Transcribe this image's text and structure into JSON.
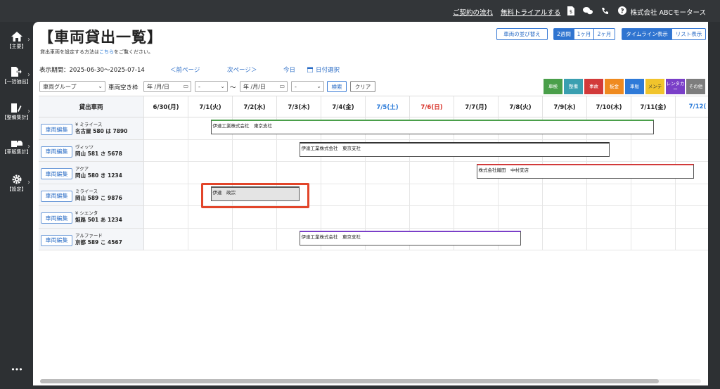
{
  "topbar": {
    "contract_flow": "ご契約の流れ",
    "free_trial": "無料トライアルする",
    "company": "株式会社 ABCモータース",
    "icons": [
      "document-yen-icon",
      "chat-icon",
      "phone-icon",
      "help-icon"
    ]
  },
  "sidebar": {
    "items": [
      {
        "label": "【主要】",
        "icon": "home-icon"
      },
      {
        "label": "【一括抽出】",
        "icon": "export-icon"
      },
      {
        "label": "【整備集計】",
        "icon": "wrench-icon"
      },
      {
        "label": "【車販集計】",
        "icon": "car-icon"
      },
      {
        "label": "【設定】",
        "icon": "gear-icon"
      }
    ],
    "more": "•••"
  },
  "page": {
    "title": "【車両貸出一覧】",
    "subtitle_pre": "貸出車両を設定する方法は",
    "subtitle_link": "こちら",
    "subtitle_post": "をご覧ください。"
  },
  "toolbar": {
    "reorder": "車両の並び替え",
    "range": [
      "2週間",
      "1ヶ月",
      "2ヶ月"
    ],
    "range_active": "2週間",
    "view": [
      "タイムライン表示",
      "リスト表示"
    ],
    "view_active": "タイムライン表示"
  },
  "nav": {
    "period": "表示期間：2025-06-30〜2025-07-14",
    "prev": "＜前ページ",
    "next": "次ページ＞",
    "today": "今日",
    "date_select": "日付選択"
  },
  "filters": {
    "group": "車両グループ",
    "vacancy_label": "車両空き枠",
    "date_placeholder": "年 /月/日",
    "time_placeholder": "-",
    "tilde": "〜",
    "search": "検索",
    "clear": "クリア"
  },
  "legend": [
    {
      "label": "車検",
      "color": "#4a9f4a"
    },
    {
      "label": "整備",
      "color": "#3a9fb0"
    },
    {
      "label": "事故",
      "color": "#d23a3a"
    },
    {
      "label": "板金",
      "color": "#ef8a1f"
    },
    {
      "label": "車販",
      "color": "#2e7ad8"
    },
    {
      "label": "メンテ",
      "color": "#f1c42c"
    },
    {
      "label": "レンタカー",
      "color": "#7a3fc8"
    },
    {
      "label": "その他",
      "color": "#7d7d7d"
    }
  ],
  "grid": {
    "vehicle_header": "貸出車両",
    "dates": [
      {
        "label": "6/30(月)",
        "color": "#222"
      },
      {
        "label": "7/1(火)",
        "color": "#222"
      },
      {
        "label": "7/2(水)",
        "color": "#222"
      },
      {
        "label": "7/3(木)",
        "color": "#222"
      },
      {
        "label": "7/4(金)",
        "color": "#222"
      },
      {
        "label": "7/5(土)",
        "color": "#2a7ad8"
      },
      {
        "label": "7/6(日)",
        "color": "#d9342b"
      },
      {
        "label": "7/7(月)",
        "color": "#222"
      },
      {
        "label": "7/8(火)",
        "color": "#222"
      },
      {
        "label": "7/9(水)",
        "color": "#222"
      },
      {
        "label": "7/10(木)",
        "color": "#222"
      },
      {
        "label": "7/11(金)",
        "color": "#222"
      },
      {
        "label": "7/12(",
        "color": "#2a7ad8"
      }
    ],
    "edit_label": "車両編集",
    "vehicles": [
      {
        "name": "¥ ミライース",
        "plate": "名古屋 580 は 7890"
      },
      {
        "name": "ヴィッツ",
        "plate": "岡山 581 さ 5678"
      },
      {
        "name": "アクア",
        "plate": "岡山 580 き 1234"
      },
      {
        "name": "ミライース",
        "plate": "岡山 589 こ 9876"
      },
      {
        "name": "¥ シエンタ",
        "plate": "姫路 501 あ 1234"
      },
      {
        "name": "アルファード",
        "plate": "京都 589 こ 4567"
      }
    ],
    "bookings": [
      {
        "row": 0,
        "start": 1.5,
        "end": 11.5,
        "label": "伊達工業株式会社　東京支社",
        "accent": "#4a9f4a",
        "fill": "#ffffff"
      },
      {
        "row": 1,
        "start": 3.5,
        "end": 10.5,
        "label": "伊達工業株式会社　東京支社",
        "accent": "#333333",
        "fill": "#ffffff"
      },
      {
        "row": 2,
        "start": 7.5,
        "end": 13,
        "label": "株式会社織田　中村支店",
        "accent": "#d23a3a",
        "fill": "#ffffff"
      },
      {
        "row": 3,
        "start": 1.5,
        "end": 3.5,
        "label": "伊達　政宗",
        "accent": "#555555",
        "fill": "#e4e4e4"
      },
      {
        "row": 5,
        "start": 3.5,
        "end": 8.5,
        "label": "伊達工業株式会社　東京支社",
        "accent": "#7a3fc8",
        "fill": "#ffffff"
      }
    ],
    "highlight_row": 3
  }
}
